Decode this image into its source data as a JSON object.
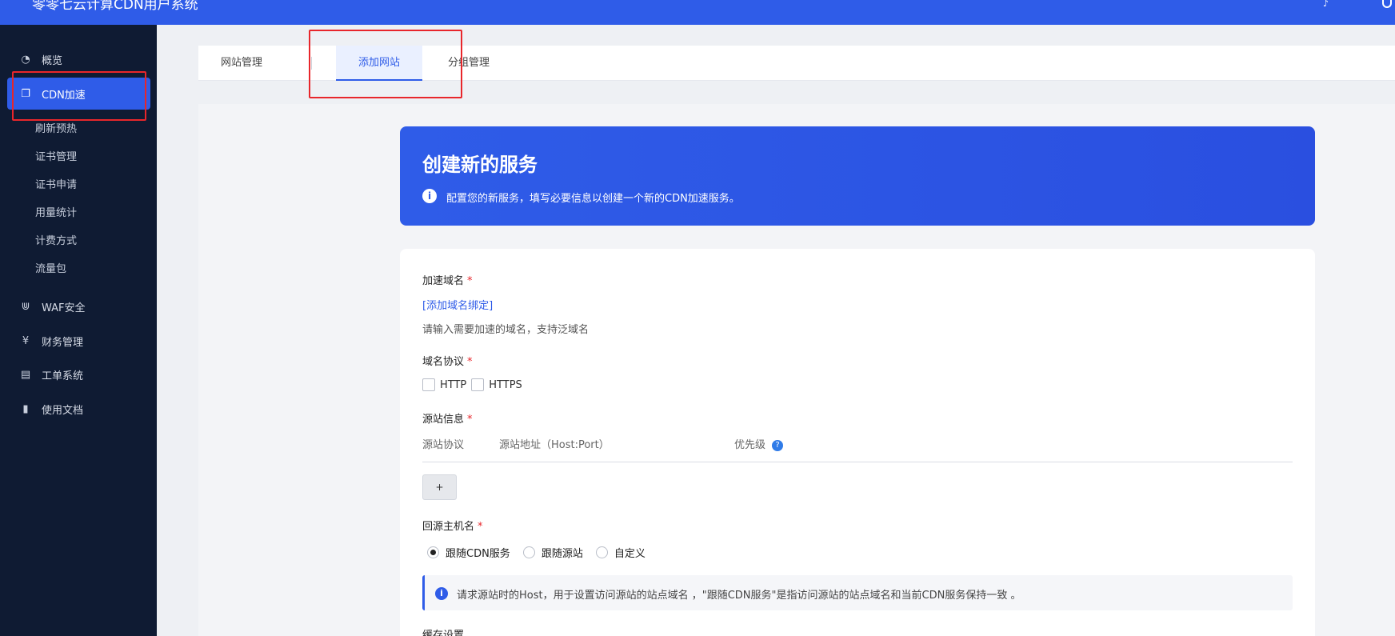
{
  "header": {
    "title": "零零七云计算CDN用户系统"
  },
  "sidebar": {
    "items": [
      {
        "label": "概览",
        "icon": "dashboard-icon"
      },
      {
        "label": "CDN加速",
        "icon": "copy-icon"
      },
      {
        "label": "WAF安全",
        "icon": "magnet-icon"
      },
      {
        "label": "财务管理",
        "icon": "yen-icon"
      },
      {
        "label": "工单系统",
        "icon": "ticket-icon"
      },
      {
        "label": "使用文档",
        "icon": "book-icon"
      }
    ],
    "subitems": [
      "刷新预热",
      "证书管理",
      "证书申请",
      "用量统计",
      "计费方式",
      "流量包"
    ]
  },
  "tabs": [
    "网站管理",
    "添加网站",
    "分组管理"
  ],
  "hero": {
    "title": "创建新的服务",
    "description": "配置您的新服务，填写必要信息以创建一个新的CDN加速服务。"
  },
  "form": {
    "domain_label": "加速域名",
    "domain_link": "[添加域名绑定]",
    "domain_hint": "请输入需要加速的域名，支持泛域名",
    "protocol_label": "域名协议",
    "protocol_options": [
      "HTTP",
      "HTTPS"
    ],
    "origin_label": "源站信息",
    "origin_columns": [
      "源站协议",
      "源站地址（Host:Port）",
      "优先级"
    ],
    "add_button": "+",
    "host_label": "回源主机名",
    "host_options": [
      "跟随CDN服务",
      "跟随源站",
      "自定义"
    ],
    "host_selected": 0,
    "host_notice": "请求源站时的Host，用于设置访问源站的站点域名 ，\"跟随CDN服务\"是指访问源站的站点域名和当前CDN服务保持一致 。",
    "cache_label": "缓存设置",
    "required_mark": "*"
  },
  "colors": {
    "primary": "#2f5ce8",
    "sidebar": "#0f1b33",
    "annotation": "#e8262b"
  }
}
